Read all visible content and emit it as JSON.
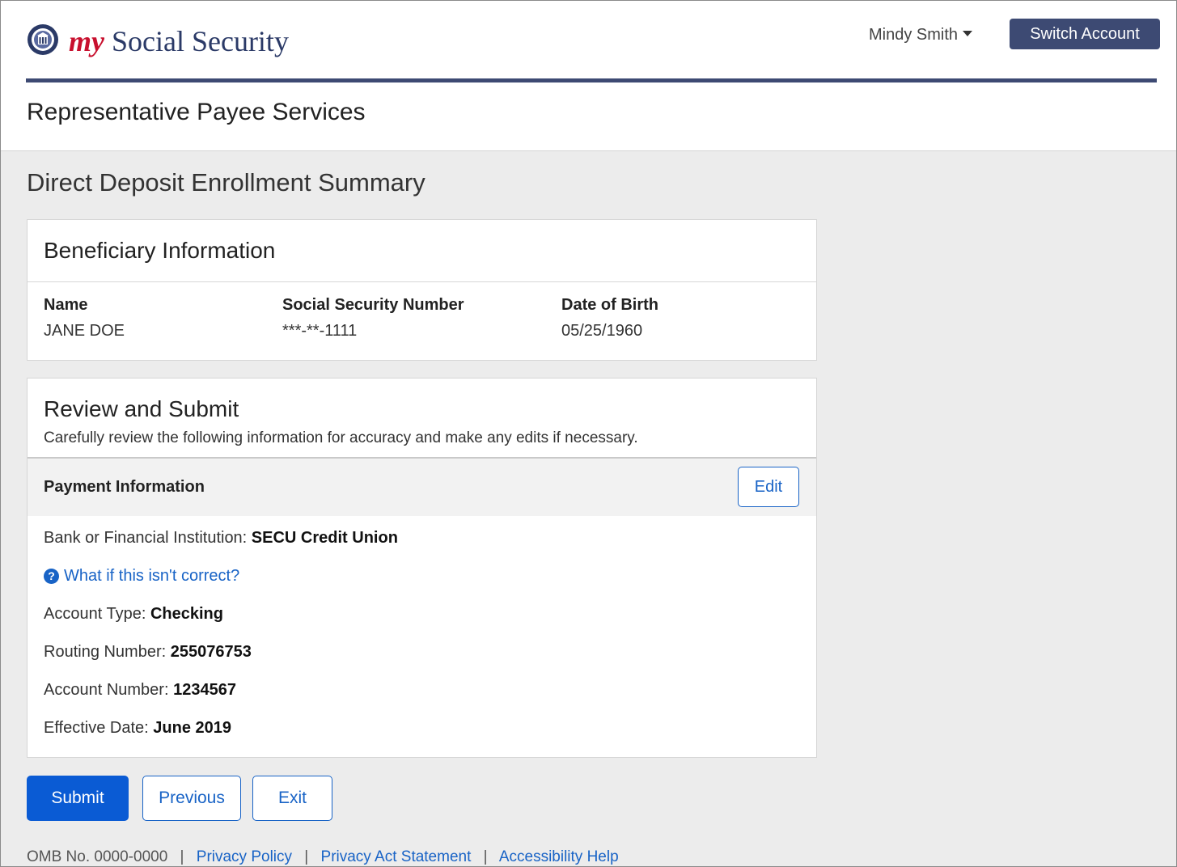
{
  "header": {
    "brand_my": "my",
    "brand_rest": "Social Security",
    "user_name": "Mindy Smith",
    "switch_account_label": "Switch Account",
    "section_title": "Representative Payee Services"
  },
  "page": {
    "title": "Direct Deposit Enrollment Summary"
  },
  "beneficiary": {
    "title": "Beneficiary Information",
    "name_label": "Name",
    "name_value": "JANE DOE",
    "ssn_label": "Social Security Number",
    "ssn_value": "***-**-1111",
    "dob_label": "Date of Birth",
    "dob_value": "05/25/1960"
  },
  "review": {
    "title": "Review and Submit",
    "description": "Carefully review the following information for accuracy and make any edits if necessary.",
    "payment_title": "Payment Information",
    "edit_label": "Edit",
    "bank_label": "Bank or Financial Institution: ",
    "bank_value": "SECU Credit Union",
    "help_link": "What if this isn't correct?",
    "account_type_label": "Account Type: ",
    "account_type_value": "Checking",
    "routing_label": "Routing Number: ",
    "routing_value": "255076753",
    "account_number_label": "Account Number: ",
    "account_number_value": "1234567",
    "effective_label": "Effective Date: ",
    "effective_value": "June 2019"
  },
  "actions": {
    "submit_label": "Submit",
    "previous_label": "Previous",
    "exit_label": "Exit"
  },
  "footer": {
    "omb": "OMB No. 0000-0000",
    "privacy_policy": "Privacy Policy",
    "privacy_act": "Privacy Act Statement",
    "accessibility": "Accessibility Help",
    "separator": "|"
  },
  "colors": {
    "brand_navy": "#3d4a73",
    "brand_red": "#c8102e",
    "link_blue": "#1863c6",
    "primary_button": "#0a5bd4",
    "page_background": "#ececec"
  },
  "icons": {
    "logo": "ssa-seal-icon",
    "user_caret": "caret-down-icon",
    "help": "question-circle-icon"
  }
}
